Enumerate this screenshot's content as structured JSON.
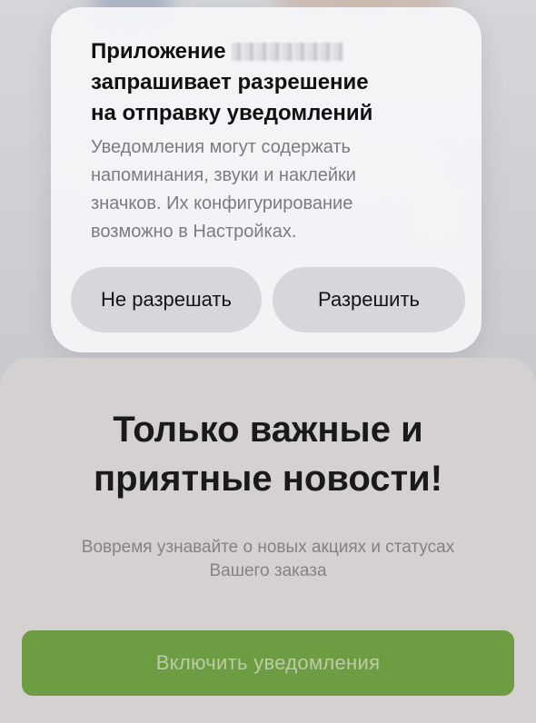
{
  "alert": {
    "title_line1": "Приложение",
    "title_line2": "запрашивает разрешение",
    "title_line3": "на отправку уведомлений",
    "body_line1": "Уведомления могут содержать",
    "body_line2": "напоминания, звуки и наклейки",
    "body_line3": "значков. Их конфигурирование",
    "body_line4": "возможно в Настройках.",
    "deny_label": "Не разрешать",
    "allow_label": "Разрешить"
  },
  "sheet": {
    "title_line1": "Только важные и",
    "title_line2": "приятные новости!",
    "subtitle_line1": "Вовремя узнавайте о новых акциях и статусах",
    "subtitle_line2": "Вашего заказа",
    "enable_label": "Включить уведомления"
  },
  "colors": {
    "accent_green": "#6e9c43",
    "sheet_bg": "#d5d1d1",
    "alert_bg": "#f5f5f8"
  }
}
